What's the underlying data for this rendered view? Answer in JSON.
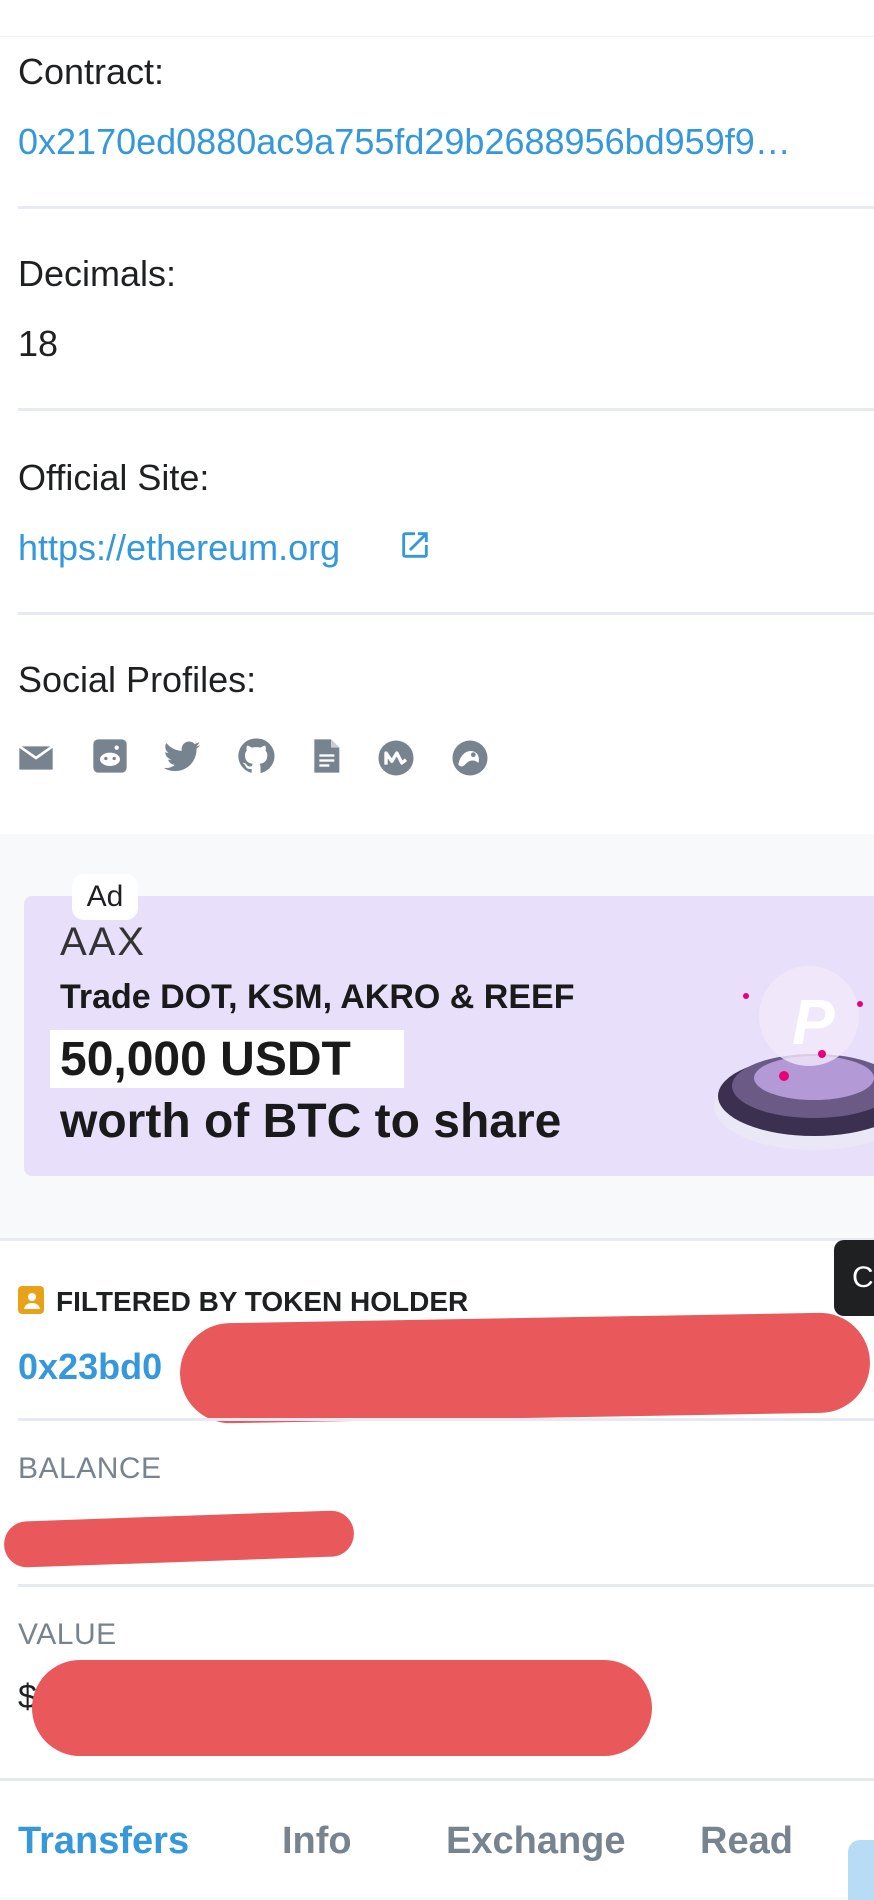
{
  "token_info": {
    "contract_label": "Contract:",
    "contract_value": "0x2170ed0880ac9a755fd29b2688956bd959f9…",
    "decimals_label": "Decimals:",
    "decimals_value": "18",
    "site_label": "Official Site:",
    "site_value": "https://ethereum.org",
    "social_label": "Social Profiles:",
    "social_icons": [
      "email-icon",
      "reddit-icon",
      "twitter-icon",
      "github-icon",
      "whitepaper-icon",
      "coinmarketcap-icon",
      "coingecko-icon"
    ]
  },
  "ad": {
    "tag": "Ad",
    "brand": "AAX",
    "line1": "Trade DOT, KSM, AKRO & REEF",
    "line2": "50,000 USDT",
    "line3": "worth of BTC to share"
  },
  "holder": {
    "filter_label": "FILTERED BY TOKEN HOLDER",
    "address_visible": "0x23bd0",
    "balance_label": "BALANCE",
    "value_label": "VALUE",
    "value_prefix": "$",
    "side_button": "C"
  },
  "tabs": [
    {
      "label": "Transfers",
      "active": true
    },
    {
      "label": "Info",
      "active": false
    },
    {
      "label": "Exchange",
      "active": false
    },
    {
      "label": "Read",
      "active": false
    }
  ],
  "colors": {
    "link": "#3498db",
    "muted": "#77838f",
    "redaction": "#e9585a",
    "ad_background": "#e8e0fb",
    "badge": "#e8a21a"
  }
}
